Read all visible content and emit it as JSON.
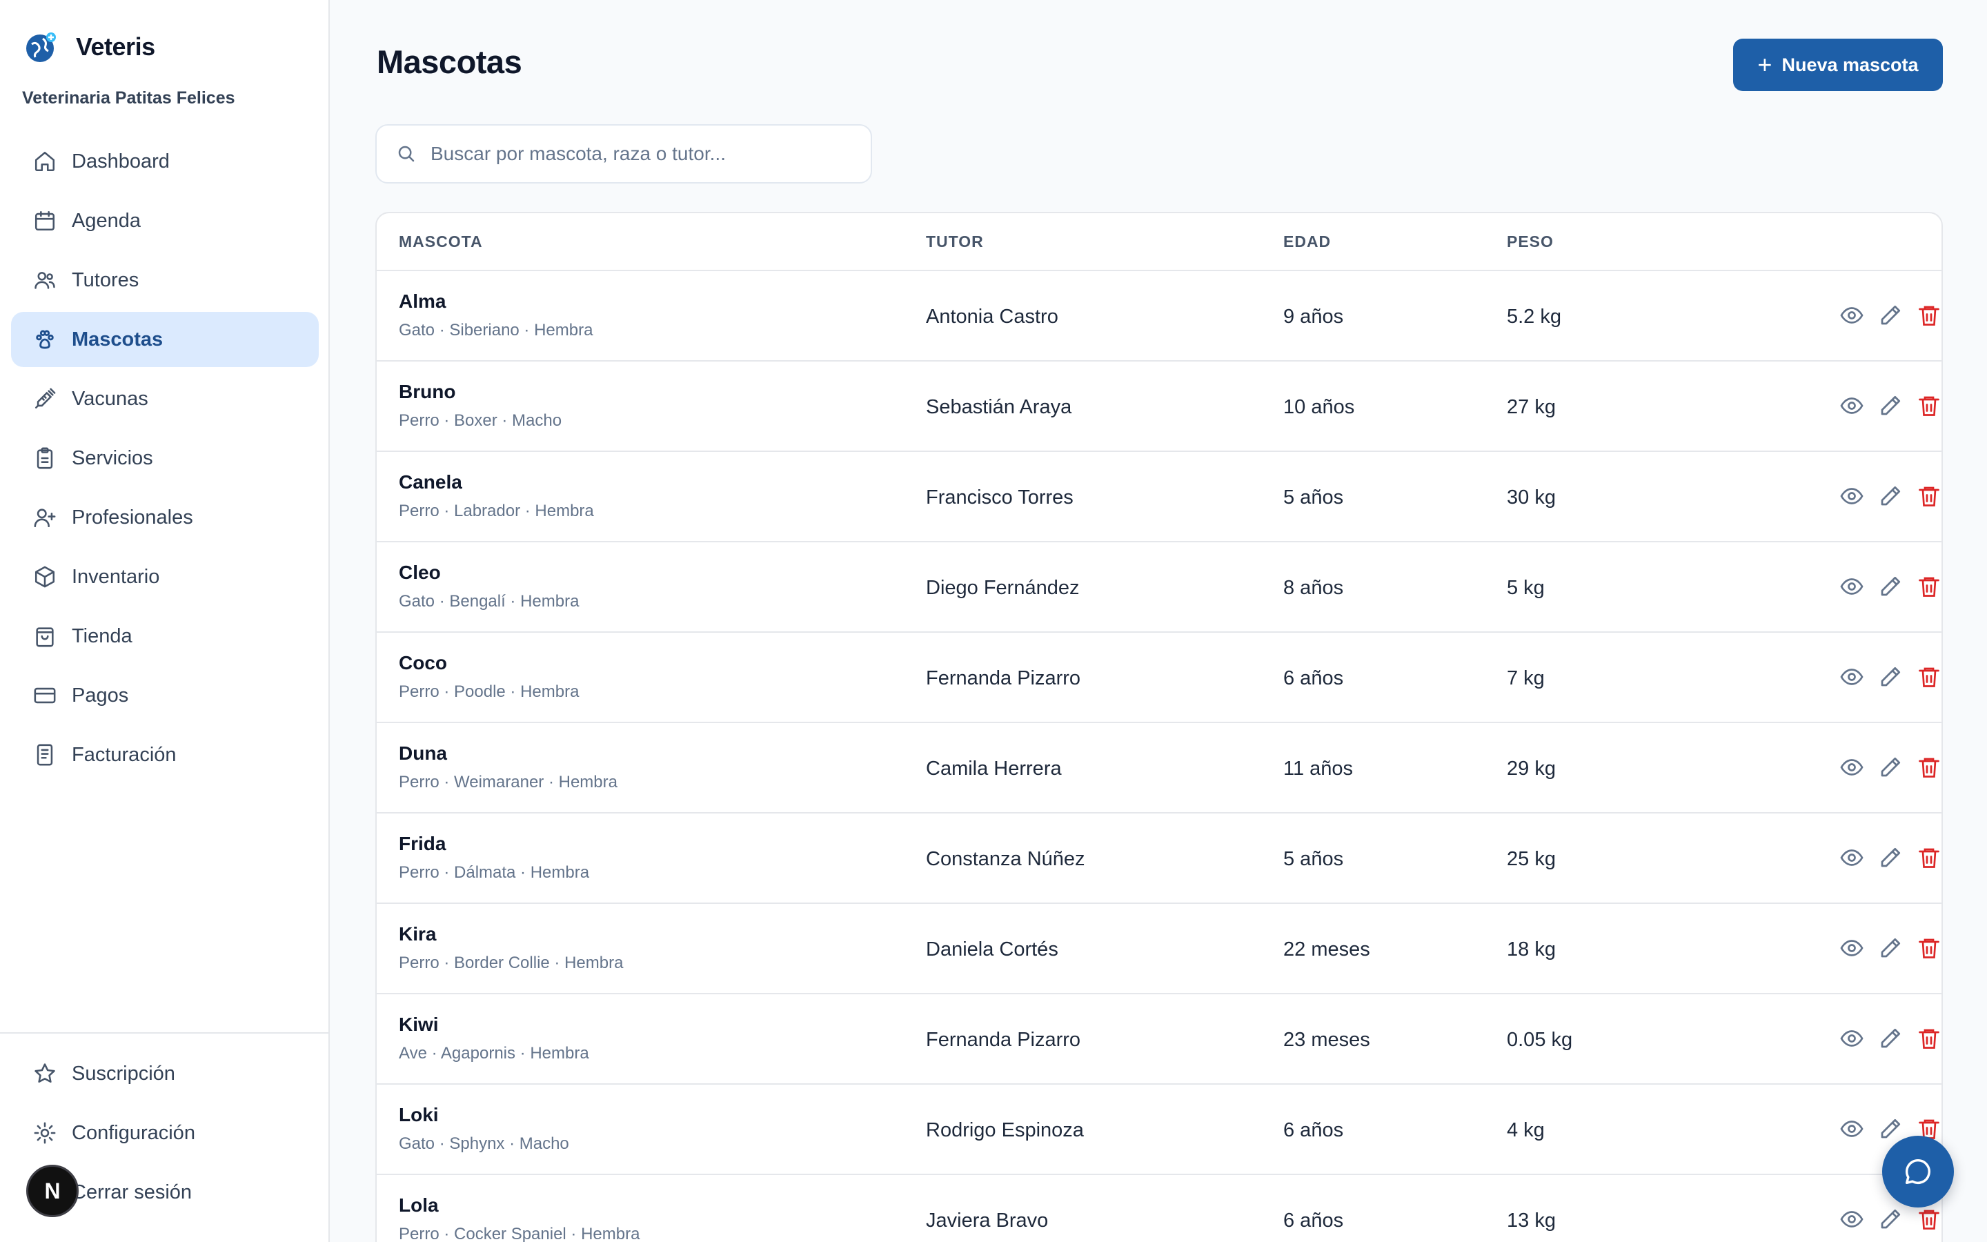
{
  "brand": {
    "name": "Veteris",
    "clinic": "Veterinaria Patitas Felices"
  },
  "nav": [
    {
      "label": "Dashboard",
      "icon": "home-icon"
    },
    {
      "label": "Agenda",
      "icon": "calendar-icon"
    },
    {
      "label": "Tutores",
      "icon": "users-icon"
    },
    {
      "label": "Mascotas",
      "icon": "paw-icon",
      "active": true
    },
    {
      "label": "Vacunas",
      "icon": "syringe-icon"
    },
    {
      "label": "Servicios",
      "icon": "clipboard-icon"
    },
    {
      "label": "Profesionales",
      "icon": "user-plus-icon"
    },
    {
      "label": "Inventario",
      "icon": "box-icon"
    },
    {
      "label": "Tienda",
      "icon": "shopping-bag-icon"
    },
    {
      "label": "Pagos",
      "icon": "credit-card-icon"
    },
    {
      "label": "Facturación",
      "icon": "receipt-icon"
    }
  ],
  "nav_bottom": [
    {
      "label": "Suscripción",
      "icon": "star-icon"
    },
    {
      "label": "Configuración",
      "icon": "settings-icon"
    },
    {
      "label": "Cerrar sesión",
      "icon": "logout-icon"
    }
  ],
  "user": {
    "initial": "N"
  },
  "page": {
    "title": "Mascotas",
    "new_button": "Nueva mascota"
  },
  "search": {
    "placeholder": "Buscar por mascota, raza o tutor..."
  },
  "table": {
    "headers": {
      "pet": "MASCOTA",
      "tutor": "TUTOR",
      "age": "EDAD",
      "weight": "PESO"
    },
    "rows": [
      {
        "name": "Alma",
        "meta": "Gato · Siberiano · Hembra",
        "tutor": "Antonia Castro",
        "age": "9 años",
        "weight": "5.2 kg"
      },
      {
        "name": "Bruno",
        "meta": "Perro · Boxer · Macho",
        "tutor": "Sebastián Araya",
        "age": "10 años",
        "weight": "27 kg"
      },
      {
        "name": "Canela",
        "meta": "Perro · Labrador · Hembra",
        "tutor": "Francisco Torres",
        "age": "5 años",
        "weight": "30 kg"
      },
      {
        "name": "Cleo",
        "meta": "Gato · Bengalí · Hembra",
        "tutor": "Diego Fernández",
        "age": "8 años",
        "weight": "5 kg"
      },
      {
        "name": "Coco",
        "meta": "Perro · Poodle · Hembra",
        "tutor": "Fernanda Pizarro",
        "age": "6 años",
        "weight": "7 kg"
      },
      {
        "name": "Duna",
        "meta": "Perro · Weimaraner · Hembra",
        "tutor": "Camila Herrera",
        "age": "11 años",
        "weight": "29 kg"
      },
      {
        "name": "Frida",
        "meta": "Perro · Dálmata · Hembra",
        "tutor": "Constanza Núñez",
        "age": "5 años",
        "weight": "25 kg"
      },
      {
        "name": "Kira",
        "meta": "Perro · Border Collie · Hembra",
        "tutor": "Daniela Cortés",
        "age": "22 meses",
        "weight": "18 kg"
      },
      {
        "name": "Kiwi",
        "meta": "Ave · Agapornis · Hembra",
        "tutor": "Fernanda Pizarro",
        "age": "23 meses",
        "weight": "0.05 kg"
      },
      {
        "name": "Loki",
        "meta": "Gato · Sphynx · Macho",
        "tutor": "Rodrigo Espinoza",
        "age": "6 años",
        "weight": "4 kg"
      },
      {
        "name": "Lola",
        "meta": "Perro · Cocker Spaniel · Hembra",
        "tutor": "Javiera Bravo",
        "age": "6 años",
        "weight": "13 kg"
      }
    ]
  },
  "colors": {
    "primary": "#1e5fa8",
    "active_bg": "#dbeafe",
    "danger": "#dc2626"
  }
}
